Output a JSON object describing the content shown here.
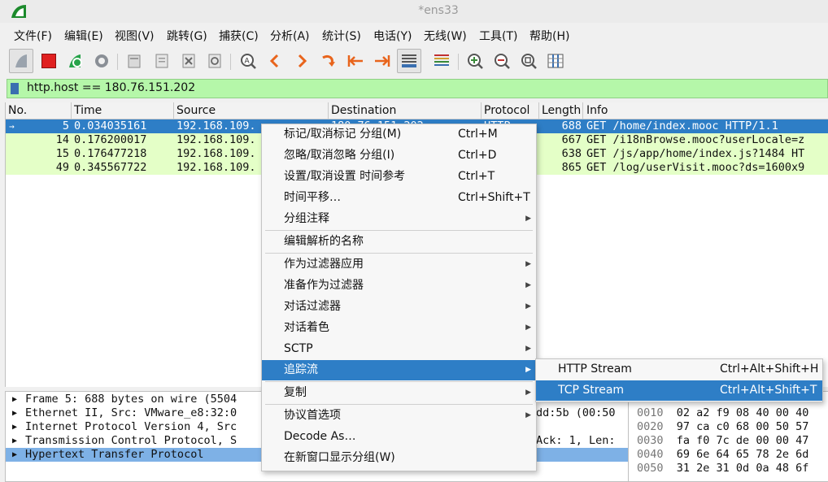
{
  "window": {
    "title": "*ens33"
  },
  "menubar": [
    {
      "label": "文件(F)"
    },
    {
      "label": "编辑(E)"
    },
    {
      "label": "视图(V)"
    },
    {
      "label": "跳转(G)"
    },
    {
      "label": "捕获(C)"
    },
    {
      "label": "分析(A)"
    },
    {
      "label": "统计(S)"
    },
    {
      "label": "电话(Y)"
    },
    {
      "label": "无线(W)"
    },
    {
      "label": "工具(T)"
    },
    {
      "label": "帮助(H)"
    }
  ],
  "toolbar": {
    "icons": [
      "shark-fin-start-icon",
      "stop-square-icon",
      "restart-capture-icon",
      "capture-options-gear-icon",
      "open-file-icon",
      "save-file-icon",
      "close-file-icon",
      "reload-file-icon",
      "find-packet-icon",
      "go-back-arrow-icon",
      "go-forward-arrow-icon",
      "go-to-packet-icon",
      "first-packet-icon",
      "last-packet-icon",
      "autoscroll-icon",
      "colorize-icon",
      "zoom-in-icon",
      "zoom-out-icon",
      "normal-size-icon",
      "resize-columns-icon"
    ],
    "colors": {
      "stop": "#e02020",
      "arrow": "#e8641c"
    }
  },
  "filter": {
    "value": "http.host == 180.76.151.202",
    "bar_color": "#b5f7a9"
  },
  "packet_list": {
    "columns": [
      "No.",
      "Time",
      "Source",
      "Destination",
      "Protocol",
      "Length",
      "Info"
    ],
    "rows": [
      {
        "no": "5",
        "time": "0.034035161",
        "source": "192.168.109.",
        "destination": "180.76.151.202",
        "protocol": "HTTP",
        "length": "688",
        "info": "GET /home/index.mooc HTTP/1.1"
      },
      {
        "no": "14",
        "time": "0.176200017",
        "source": "192.168.109.",
        "destination": "",
        "protocol": "",
        "length": "667",
        "info": "GET /i18nBrowse.mooc?userLocale=z"
      },
      {
        "no": "15",
        "time": "0.176477218",
        "source": "192.168.109.",
        "destination": "",
        "protocol": "",
        "length": "638",
        "info": "GET /js/app/home/index.js?1484 HT"
      },
      {
        "no": "49",
        "time": "0.345567722",
        "source": "192.168.109.",
        "destination": "",
        "protocol": "",
        "length": "865",
        "info": "GET /log/userVisit.mooc?ds=1600x9"
      }
    ],
    "selected_color": "#2e7ec6",
    "row_color": "#e4ffc7"
  },
  "details": [
    {
      "text": "Frame 5: 688 bytes on wire (5504"
    },
    {
      "text": "Ethernet II, Src: VMware_e8:32:0"
    },
    {
      "text": "Internet Protocol Version 4, Src"
    },
    {
      "text": "Transmission Control Protocol, S"
    },
    {
      "text": "Hypertext Transfer Protocol"
    }
  ],
  "details_fragments": {
    "eth_tail": "dd:5b (00:50",
    "tcp_tail": "Ack: 1, Len:"
  },
  "hex": [
    {
      "offset": "0010",
      "bytes": "02 a2 f9 08 40 00 40"
    },
    {
      "offset": "0020",
      "bytes": "97 ca c0 68 00 50 57"
    },
    {
      "offset": "0030",
      "bytes": "fa f0 7c de 00 00 47"
    },
    {
      "offset": "0040",
      "bytes": "69 6e 64 65 78 2e 6d"
    },
    {
      "offset": "0050",
      "bytes": "31 2e 31 0d 0a 48 6f"
    }
  ],
  "context_menu": [
    {
      "label": "标记/取消标记 分组(M)",
      "shortcut": "Ctrl+M"
    },
    {
      "label": "忽略/取消忽略 分组(I)",
      "shortcut": "Ctrl+D"
    },
    {
      "label": "设置/取消设置 时间参考",
      "shortcut": "Ctrl+T"
    },
    {
      "label": "时间平移…",
      "shortcut": "Ctrl+Shift+T"
    },
    {
      "label": "分组注释",
      "submenu": true
    },
    {
      "label": "编辑解析的名称"
    },
    {
      "label": "作为过滤器应用",
      "submenu": true
    },
    {
      "label": "准备作为过滤器",
      "submenu": true
    },
    {
      "label": "对话过滤器",
      "submenu": true
    },
    {
      "label": "对话着色",
      "submenu": true
    },
    {
      "label": "SCTP",
      "submenu": true
    },
    {
      "label": "追踪流",
      "submenu": true,
      "active": true
    },
    {
      "label": "复制",
      "submenu": true
    },
    {
      "label": "协议首选项",
      "submenu": true
    },
    {
      "label": "Decode As…"
    },
    {
      "label": "在新窗口显示分组(W)"
    }
  ],
  "follow_submenu": [
    {
      "label": "HTTP Stream",
      "shortcut": "Ctrl+Alt+Shift+H"
    },
    {
      "label": "TCP Stream",
      "shortcut": "Ctrl+Alt+Shift+T",
      "active": true
    }
  ]
}
